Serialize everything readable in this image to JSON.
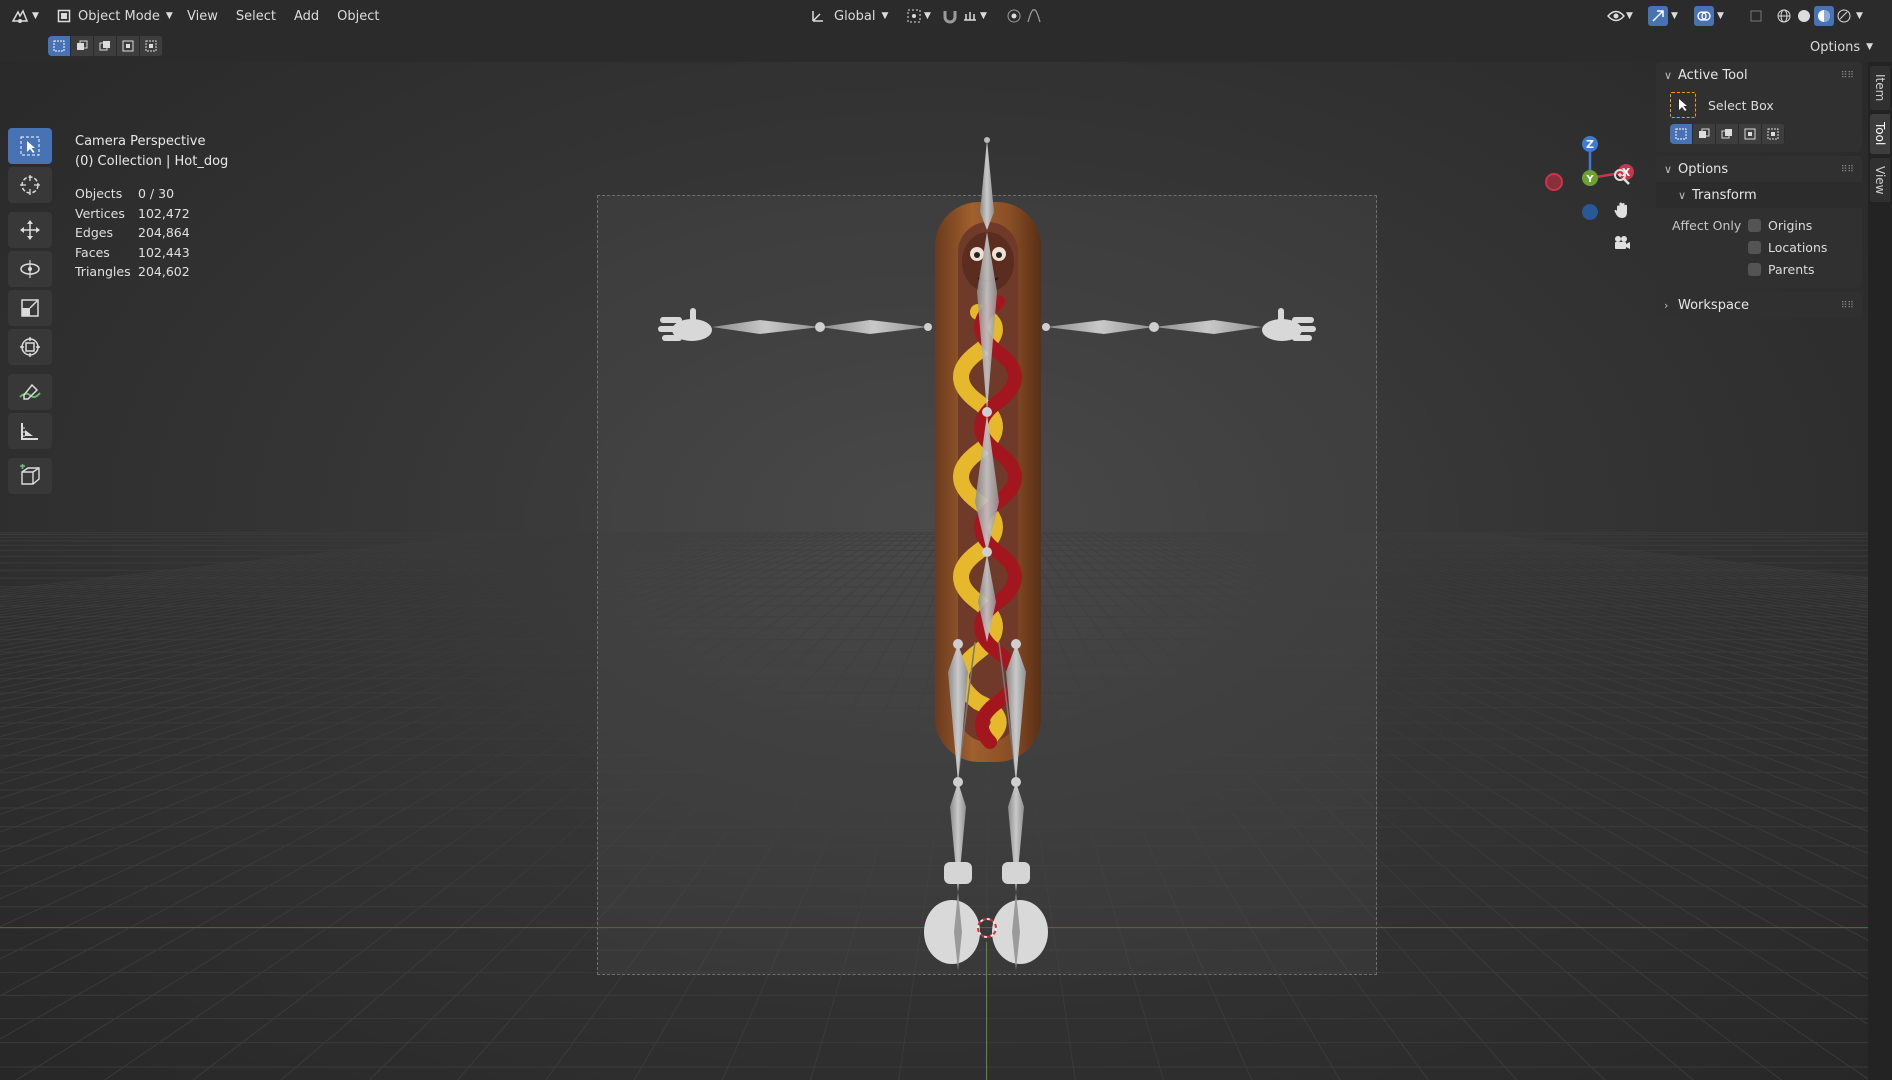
{
  "header": {
    "mode": "Object Mode",
    "menus": [
      "View",
      "Select",
      "Add",
      "Object"
    ],
    "transform_orientation": "Global",
    "options_label": "Options"
  },
  "viewport": {
    "perspective": "Camera Perspective",
    "collection": "(0) Collection | Hot_dog",
    "stats": [
      {
        "label": "Objects",
        "value": "0 / 30"
      },
      {
        "label": "Vertices",
        "value": "102,472"
      },
      {
        "label": "Edges",
        "value": "204,864"
      },
      {
        "label": "Faces",
        "value": "102,443"
      },
      {
        "label": "Triangles",
        "value": "204,602"
      }
    ],
    "gizmo": {
      "z": "Z",
      "y": "Y",
      "x": "X"
    }
  },
  "toolbar": {
    "tools": [
      "select-box",
      "cursor",
      "move",
      "rotate",
      "scale",
      "transform",
      "annotate",
      "measure",
      "add-cube"
    ]
  },
  "npanel": {
    "active_tool": {
      "title": "Active Tool",
      "tool_name": "Select Box"
    },
    "options": {
      "title": "Options",
      "transform": "Transform",
      "affect_only": "Affect Only",
      "checkboxes": [
        {
          "label": "Origins",
          "checked": false
        },
        {
          "label": "Locations",
          "checked": false
        },
        {
          "label": "Parents",
          "checked": false
        }
      ]
    },
    "workspace": "Workspace",
    "tabs": [
      "Item",
      "Tool",
      "View"
    ]
  },
  "colors": {
    "accent": "#4772b3",
    "x_axis": "#c8364a",
    "y_axis": "#6aa131",
    "z_axis": "#3b7bd4"
  }
}
